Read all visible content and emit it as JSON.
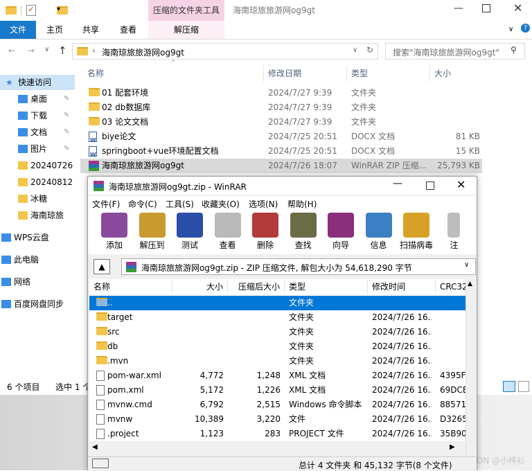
{
  "explorer": {
    "contextual_group": "压缩的文件夹工具",
    "window_title": "海南琼旅旅游网og9gt",
    "tabs": [
      "文件",
      "主页",
      "共享",
      "查看",
      "解压缩"
    ],
    "breadcrumb": "海南琼旅旅游网og9gt",
    "search_placeholder": "搜索\"海南琼旅旅游网og9gt\"",
    "columns": [
      "名称",
      "修改日期",
      "类型",
      "大小"
    ],
    "sidebar": [
      {
        "label": "快速访问",
        "icon": "star-icon"
      },
      {
        "label": "桌面",
        "icon": "desktop-icon"
      },
      {
        "label": "下载",
        "icon": "download-icon"
      },
      {
        "label": "文档",
        "icon": "document-icon"
      },
      {
        "label": "图片",
        "icon": "picture-icon"
      },
      {
        "label": "20240726",
        "icon": "folder-icon"
      },
      {
        "label": "20240812",
        "icon": "folder-icon"
      },
      {
        "label": "冰糖",
        "icon": "folder-icon"
      },
      {
        "label": "海南琼旅",
        "icon": "folder-icon"
      },
      {
        "label": "WPS云盘",
        "icon": "cloud-icon"
      },
      {
        "label": "此电脑",
        "icon": "computer-icon"
      },
      {
        "label": "网络",
        "icon": "network-icon"
      },
      {
        "label": "百度网盘同步",
        "icon": "baidu-icon"
      }
    ],
    "files": [
      {
        "name": "01 配套环境",
        "date": "2024/7/27 9:39",
        "type": "文件夹",
        "size": "",
        "icon": "folder"
      },
      {
        "name": "02 db数据库",
        "date": "2024/7/27 9:39",
        "type": "文件夹",
        "size": "",
        "icon": "folder"
      },
      {
        "name": "03 论文文档",
        "date": "2024/7/27 9:39",
        "type": "文件夹",
        "size": "",
        "icon": "folder"
      },
      {
        "name": "biye论文",
        "date": "2024/7/25 20:51",
        "type": "DOCX 文档",
        "size": "81 KB",
        "icon": "doc"
      },
      {
        "name": "springboot+vue环境配置文档",
        "date": "2024/7/25 20:51",
        "type": "DOCX 文档",
        "size": "15 KB",
        "icon": "doc"
      },
      {
        "name": "海南琼旅旅游网og9gt",
        "date": "2024/7/26 18:07",
        "type": "WinRAR ZIP 压缩...",
        "size": "25,793 KB",
        "icon": "rar"
      }
    ],
    "status": {
      "count": "6 个项目",
      "selected": "选中 1 个"
    }
  },
  "winrar": {
    "title": "海南琼旅旅游网og9gt.zip - WinRAR",
    "menu": [
      "文件(F)",
      "命令(C)",
      "工具(S)",
      "收藏夹(O)",
      "选项(N)",
      "帮助(H)"
    ],
    "toolbar": [
      {
        "label": "添加",
        "icon": "add-archive-icon",
        "color": "#8a4a9c"
      },
      {
        "label": "解压到",
        "icon": "extract-icon",
        "color": "#c99a2e"
      },
      {
        "label": "测试",
        "icon": "test-icon",
        "color": "#2a4fa8"
      },
      {
        "label": "查看",
        "icon": "view-icon",
        "color": "#b9b9b9"
      },
      {
        "label": "删除",
        "icon": "delete-icon",
        "color": "#b23a3a"
      },
      {
        "label": "查找",
        "icon": "find-icon",
        "color": "#6b6b45"
      },
      {
        "label": "向导",
        "icon": "wizard-icon",
        "color": "#8a2f7c"
      },
      {
        "label": "信息",
        "icon": "info-icon",
        "color": "#3b7fc4"
      },
      {
        "label": "扫描病毒",
        "icon": "scan-virus-icon",
        "color": "#d7a128"
      },
      {
        "label": "注",
        "icon": "comment-icon",
        "color": "#bdbdbd"
      }
    ],
    "path": "海南琼旅旅游网og9gt.zip - ZIP 压缩文件, 解包大小为 54,618,290 字节",
    "columns": [
      "名称",
      "大小",
      "压缩后大小",
      "类型",
      "修改时间",
      "CRC32"
    ],
    "rows": [
      {
        "name": "..",
        "size": "",
        "packed": "",
        "type": "文件夹",
        "modified": "",
        "crc": "",
        "icon": "up",
        "selected": true
      },
      {
        "name": "target",
        "size": "",
        "packed": "",
        "type": "文件夹",
        "modified": "2024/7/26 16...",
        "crc": "",
        "icon": "folder"
      },
      {
        "name": "src",
        "size": "",
        "packed": "",
        "type": "文件夹",
        "modified": "2024/7/26 16...",
        "crc": "",
        "icon": "folder"
      },
      {
        "name": "db",
        "size": "",
        "packed": "",
        "type": "文件夹",
        "modified": "2024/7/26 16...",
        "crc": "",
        "icon": "folder"
      },
      {
        "name": ".mvn",
        "size": "",
        "packed": "",
        "type": "文件夹",
        "modified": "2024/7/26 16...",
        "crc": "",
        "icon": "folder"
      },
      {
        "name": "pom-war.xml",
        "size": "4,772",
        "packed": "1,248",
        "type": "XML 文档",
        "modified": "2024/7/26 16...",
        "crc": "4395F",
        "icon": "gen"
      },
      {
        "name": "pom.xml",
        "size": "5,172",
        "packed": "1,226",
        "type": "XML 文档",
        "modified": "2024/7/26 16...",
        "crc": "69DCE",
        "icon": "gen"
      },
      {
        "name": "mvnw.cmd",
        "size": "6,792",
        "packed": "2,515",
        "type": "Windows 命令脚本",
        "modified": "2024/7/26 16...",
        "crc": "88571",
        "icon": "gen"
      },
      {
        "name": "mvnw",
        "size": "10,389",
        "packed": "3,220",
        "type": "文件",
        "modified": "2024/7/26 16...",
        "crc": "D3265",
        "icon": "gen"
      },
      {
        "name": ".project",
        "size": "1,123",
        "packed": "283",
        "type": "PROJECT 文件",
        "modified": "2024/7/26 16...",
        "crc": "35B90",
        "icon": "gen"
      }
    ],
    "status": "总计 4 文件夹 和 45,132 字节(8 个文件)"
  },
  "watermark": "CSDN @小梓衫",
  "accent": "#1979ca"
}
